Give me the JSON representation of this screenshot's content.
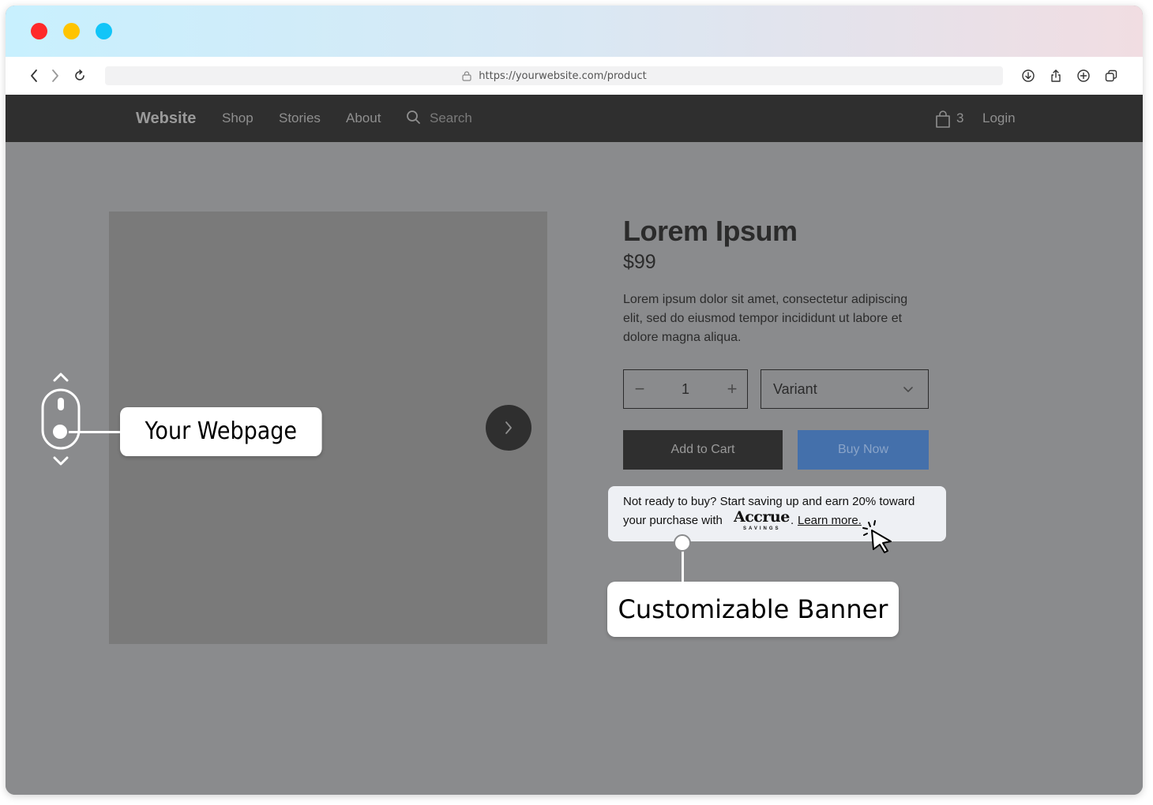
{
  "browser": {
    "url": "https://yourwebsite.com/product",
    "icons": [
      "back-icon",
      "forward-icon",
      "reload-icon",
      "lock-icon",
      "download-icon",
      "share-icon",
      "new-tab-icon",
      "tabs-icon"
    ]
  },
  "nav": {
    "brand": "Website",
    "items": [
      "Shop",
      "Stories",
      "About"
    ],
    "search_placeholder": "Search",
    "cart_count": "3",
    "login": "Login"
  },
  "product": {
    "title": "Lorem Ipsum",
    "price": "$99",
    "description": "Lorem ipsum dolor sit amet, consectetur adipiscing elit, sed do eiusmod tempor incididunt ut labore et dolore magna aliqua.",
    "quantity": "1",
    "qty_minus": "−",
    "qty_plus": "+",
    "variant": "Variant",
    "add_to_cart": "Add to Cart",
    "buy_now": "Buy Now"
  },
  "banner": {
    "line1": "Not ready to buy? Start saving up and earn 20% toward",
    "line2_prefix": "your purchase with",
    "logo_word": "Accrue",
    "logo_sub": "SAVINGS",
    "period": ".",
    "link": "Learn more."
  },
  "callouts": {
    "webpage": "Your Webpage",
    "banner": "Customizable Banner"
  },
  "colors": {
    "close": "#ff2a2a",
    "minimize": "#ffc400",
    "maximize": "#12c5f8",
    "navbar": "#2f2f2f",
    "buy_now": "#4470ab",
    "page_overlay": "#8a8b8d"
  }
}
